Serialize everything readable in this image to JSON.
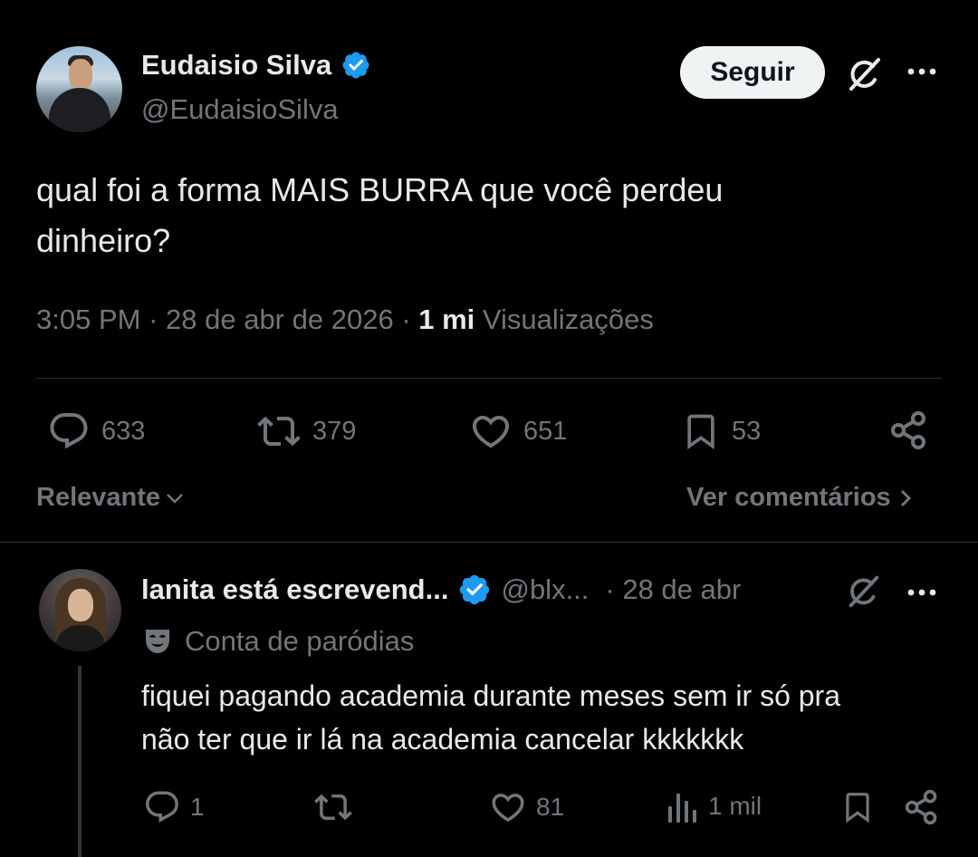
{
  "tweet": {
    "author_name": "Eudaisio Silva",
    "author_handle": "@EudaisioSilva",
    "follow_label": "Seguir",
    "text_line1": "qual foi a forma MAIS BURRA que você perdeu",
    "text_line2": "dinheiro?",
    "time": "3:05 PM",
    "date": "28 de abr de 2026",
    "views_count": "1 mi",
    "views_label": "Visualizações",
    "replies": "633",
    "reposts": "379",
    "likes": "651",
    "bookmarks": "53"
  },
  "sort": {
    "label": "Relevante",
    "see_comments": "Ver comentários"
  },
  "reply": {
    "author_name": "lanita está escrevend...",
    "author_handle": "@blx...",
    "date": "· 28 de abr",
    "parody_label": "Conta de paródias",
    "text_line1": "fiquei pagando academia durante meses sem ir só pra",
    "text_line2": "não ter que ir lá na academia cancelar kkkkkkk",
    "replies": "1",
    "likes": "81",
    "views": "1 mil"
  },
  "colors": {
    "background": "#000000",
    "text": "#e7e9ea",
    "secondary": "#71767b",
    "verified": "#1d9bf0",
    "divider": "#2f3336"
  },
  "icons": [
    "verified-badge-icon",
    "grok-icon",
    "more-icon",
    "reply-icon",
    "repost-icon",
    "like-icon",
    "bookmark-icon",
    "share-icon",
    "chevron-down-icon",
    "chevron-right-icon",
    "parody-mask-icon",
    "views-icon"
  ]
}
